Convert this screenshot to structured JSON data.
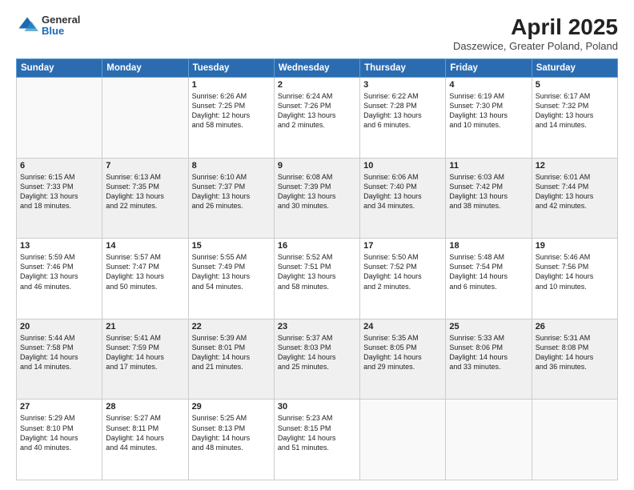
{
  "header": {
    "logo": {
      "general": "General",
      "blue": "Blue"
    },
    "title": "April 2025",
    "subtitle": "Daszewice, Greater Poland, Poland"
  },
  "calendar": {
    "weekdays": [
      "Sunday",
      "Monday",
      "Tuesday",
      "Wednesday",
      "Thursday",
      "Friday",
      "Saturday"
    ],
    "weeks": [
      [
        {
          "day": "",
          "detail": ""
        },
        {
          "day": "",
          "detail": ""
        },
        {
          "day": "1",
          "detail": "Sunrise: 6:26 AM\nSunset: 7:25 PM\nDaylight: 12 hours\nand 58 minutes."
        },
        {
          "day": "2",
          "detail": "Sunrise: 6:24 AM\nSunset: 7:26 PM\nDaylight: 13 hours\nand 2 minutes."
        },
        {
          "day": "3",
          "detail": "Sunrise: 6:22 AM\nSunset: 7:28 PM\nDaylight: 13 hours\nand 6 minutes."
        },
        {
          "day": "4",
          "detail": "Sunrise: 6:19 AM\nSunset: 7:30 PM\nDaylight: 13 hours\nand 10 minutes."
        },
        {
          "day": "5",
          "detail": "Sunrise: 6:17 AM\nSunset: 7:32 PM\nDaylight: 13 hours\nand 14 minutes."
        }
      ],
      [
        {
          "day": "6",
          "detail": "Sunrise: 6:15 AM\nSunset: 7:33 PM\nDaylight: 13 hours\nand 18 minutes."
        },
        {
          "day": "7",
          "detail": "Sunrise: 6:13 AM\nSunset: 7:35 PM\nDaylight: 13 hours\nand 22 minutes."
        },
        {
          "day": "8",
          "detail": "Sunrise: 6:10 AM\nSunset: 7:37 PM\nDaylight: 13 hours\nand 26 minutes."
        },
        {
          "day": "9",
          "detail": "Sunrise: 6:08 AM\nSunset: 7:39 PM\nDaylight: 13 hours\nand 30 minutes."
        },
        {
          "day": "10",
          "detail": "Sunrise: 6:06 AM\nSunset: 7:40 PM\nDaylight: 13 hours\nand 34 minutes."
        },
        {
          "day": "11",
          "detail": "Sunrise: 6:03 AM\nSunset: 7:42 PM\nDaylight: 13 hours\nand 38 minutes."
        },
        {
          "day": "12",
          "detail": "Sunrise: 6:01 AM\nSunset: 7:44 PM\nDaylight: 13 hours\nand 42 minutes."
        }
      ],
      [
        {
          "day": "13",
          "detail": "Sunrise: 5:59 AM\nSunset: 7:46 PM\nDaylight: 13 hours\nand 46 minutes."
        },
        {
          "day": "14",
          "detail": "Sunrise: 5:57 AM\nSunset: 7:47 PM\nDaylight: 13 hours\nand 50 minutes."
        },
        {
          "day": "15",
          "detail": "Sunrise: 5:55 AM\nSunset: 7:49 PM\nDaylight: 13 hours\nand 54 minutes."
        },
        {
          "day": "16",
          "detail": "Sunrise: 5:52 AM\nSunset: 7:51 PM\nDaylight: 13 hours\nand 58 minutes."
        },
        {
          "day": "17",
          "detail": "Sunrise: 5:50 AM\nSunset: 7:52 PM\nDaylight: 14 hours\nand 2 minutes."
        },
        {
          "day": "18",
          "detail": "Sunrise: 5:48 AM\nSunset: 7:54 PM\nDaylight: 14 hours\nand 6 minutes."
        },
        {
          "day": "19",
          "detail": "Sunrise: 5:46 AM\nSunset: 7:56 PM\nDaylight: 14 hours\nand 10 minutes."
        }
      ],
      [
        {
          "day": "20",
          "detail": "Sunrise: 5:44 AM\nSunset: 7:58 PM\nDaylight: 14 hours\nand 14 minutes."
        },
        {
          "day": "21",
          "detail": "Sunrise: 5:41 AM\nSunset: 7:59 PM\nDaylight: 14 hours\nand 17 minutes."
        },
        {
          "day": "22",
          "detail": "Sunrise: 5:39 AM\nSunset: 8:01 PM\nDaylight: 14 hours\nand 21 minutes."
        },
        {
          "day": "23",
          "detail": "Sunrise: 5:37 AM\nSunset: 8:03 PM\nDaylight: 14 hours\nand 25 minutes."
        },
        {
          "day": "24",
          "detail": "Sunrise: 5:35 AM\nSunset: 8:05 PM\nDaylight: 14 hours\nand 29 minutes."
        },
        {
          "day": "25",
          "detail": "Sunrise: 5:33 AM\nSunset: 8:06 PM\nDaylight: 14 hours\nand 33 minutes."
        },
        {
          "day": "26",
          "detail": "Sunrise: 5:31 AM\nSunset: 8:08 PM\nDaylight: 14 hours\nand 36 minutes."
        }
      ],
      [
        {
          "day": "27",
          "detail": "Sunrise: 5:29 AM\nSunset: 8:10 PM\nDaylight: 14 hours\nand 40 minutes."
        },
        {
          "day": "28",
          "detail": "Sunrise: 5:27 AM\nSunset: 8:11 PM\nDaylight: 14 hours\nand 44 minutes."
        },
        {
          "day": "29",
          "detail": "Sunrise: 5:25 AM\nSunset: 8:13 PM\nDaylight: 14 hours\nand 48 minutes."
        },
        {
          "day": "30",
          "detail": "Sunrise: 5:23 AM\nSunset: 8:15 PM\nDaylight: 14 hours\nand 51 minutes."
        },
        {
          "day": "",
          "detail": ""
        },
        {
          "day": "",
          "detail": ""
        },
        {
          "day": "",
          "detail": ""
        }
      ]
    ]
  }
}
